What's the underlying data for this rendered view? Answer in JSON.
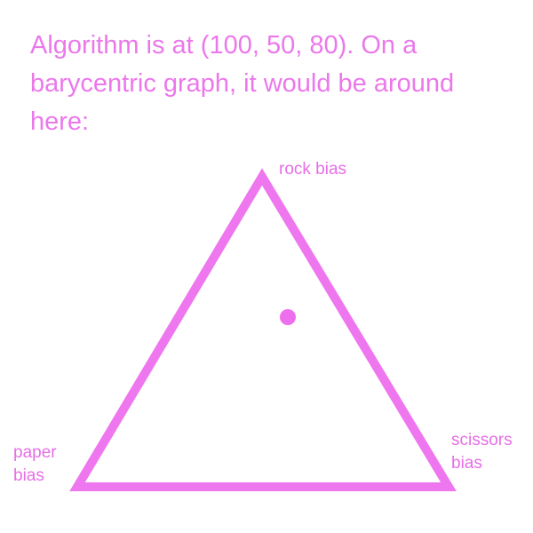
{
  "caption": "Algorithm is at (100, 50, 80). On a barycentric graph, it would be around here:",
  "vertices": {
    "rock": "rock bias",
    "paper_line1": "paper",
    "paper_line2": "bias",
    "scissors_line1": "scissors",
    "scissors_line2": "bias"
  },
  "point": {
    "rock": 100,
    "paper": 50,
    "scissors": 80
  },
  "colors": {
    "triangle_stroke": "#ee76ee",
    "point_fill": "#ee6fee",
    "text": "#eb78eb"
  }
}
